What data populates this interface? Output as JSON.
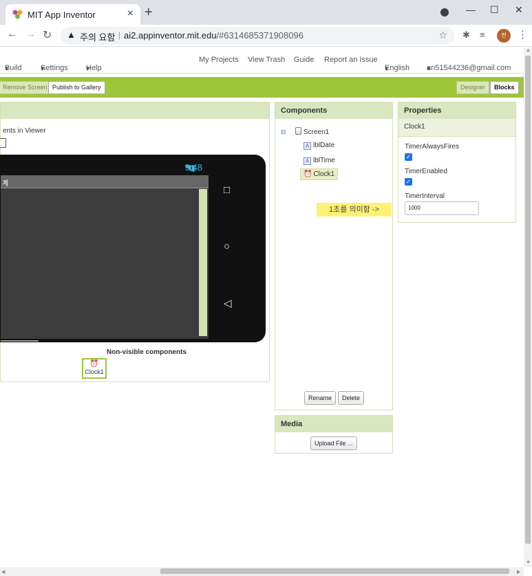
{
  "browser": {
    "tab_title": "MIT App Inventor",
    "security_warning": "주의 요함",
    "url_host": "ai2.appinventor.mit.edu",
    "url_fragment": "/#6314685371908096",
    "profile_initial": "전"
  },
  "ai_menu": {
    "build": "Build",
    "settings": "Settings",
    "help": "Help",
    "my_projects": "My Projects",
    "view_trash": "View Trash",
    "guide": "Guide",
    "report_issue": "Report an Issue",
    "language": "English",
    "account": "an51544236@gmail.com"
  },
  "toolbar": {
    "remove_screen": "Remove Screen",
    "publish_gallery": "Publish to Gallery",
    "designer": "Designer",
    "blocks": "Blocks"
  },
  "viewer": {
    "display_hidden_label": "ents in Viewer",
    "status_time": "9:48",
    "screen_title": "계",
    "nonvisible_title": "Non-visible components",
    "nonvisible_item": "Clock1"
  },
  "components": {
    "title": "Components",
    "tree": [
      "Screen1",
      "lblDate",
      "lblTime",
      "Clock1"
    ],
    "note": "1초를 의미함 ->",
    "rename": "Rename",
    "delete": "Delete"
  },
  "media": {
    "title": "Media",
    "upload": "Upload File ..."
  },
  "properties": {
    "title": "Properties",
    "selected": "Clock1",
    "timer_always_fires_label": "TimerAlwaysFires",
    "timer_enabled_label": "TimerEnabled",
    "timer_interval_label": "TimerInterval",
    "timer_interval_value": "1000"
  },
  "colors": {
    "brand_green": "#9dc63b",
    "panel_header": "#d9e6bf",
    "note_yellow": "#fff176",
    "checkbox_blue": "#1a73e8"
  }
}
